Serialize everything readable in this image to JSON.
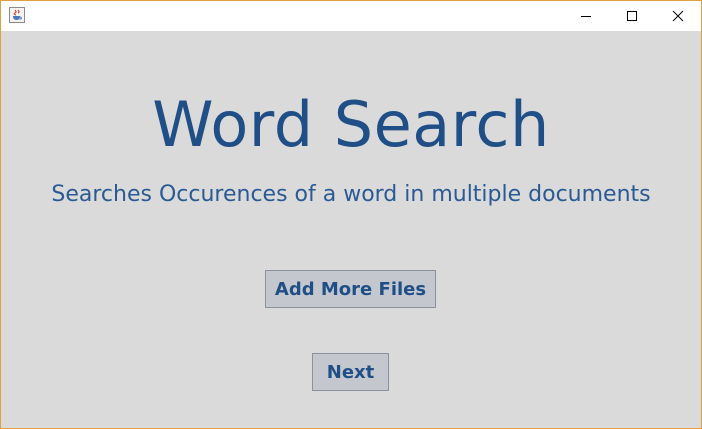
{
  "window": {
    "app_icon": "java-cup-icon",
    "controls": {
      "minimize_icon": "minimize-icon",
      "maximize_icon": "maximize-icon",
      "close_icon": "close-icon"
    }
  },
  "main": {
    "title": "Word Search",
    "subtitle": "Searches Occurences of a word in multiple documents",
    "add_files_label": "Add More Files",
    "next_label": "Next"
  },
  "colors": {
    "accent": "#1f4f86",
    "background": "#dadada",
    "button_bg": "#c4c8ce",
    "window_border": "#e0a040"
  }
}
